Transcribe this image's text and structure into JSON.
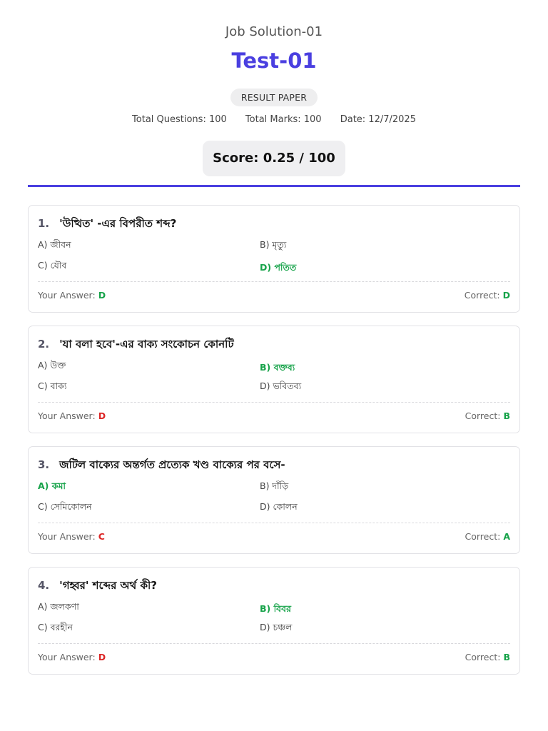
{
  "header": {
    "org": "Job Solution-01",
    "title": "Test-01",
    "badge": "RESULT PAPER",
    "total_questions": "Total Questions: 100",
    "total_marks": "Total Marks: 100",
    "date": "Date: 12/7/2025",
    "score": "Score: 0.25 / 100"
  },
  "colors": {
    "accent": "#4a3fe0",
    "correct": "#17a34a",
    "wrong": "#dc2626"
  },
  "labels": {
    "your_answer": "Your Answer:",
    "correct": "Correct:"
  },
  "questions": [
    {
      "num": "1.",
      "text": "'উত্থিত' -এর বিপরীত শব্দ?",
      "options": [
        "A) জীবন",
        "B) মৃত্যু",
        "C) যৌব",
        "D) পতিত"
      ],
      "correct_index": 3,
      "your_answer": "D",
      "correct": "D"
    },
    {
      "num": "2.",
      "text": "'যা বলা হবে'-এর বাক্য সংকোচন কোনটি",
      "options": [
        "A) উক্ত",
        "B) বক্তব্য",
        "C) বাক্য",
        "D) ভবিতব্য"
      ],
      "correct_index": 1,
      "your_answer": "D",
      "correct": "B"
    },
    {
      "num": "3.",
      "text": "জটিল বাক্যের অন্তর্গত প্রত্যেক খণ্ড বাক্যের পর বসে-",
      "options": [
        "A) কমা",
        "B) দাঁড়ি",
        "C) সেমিকোলন",
        "D) কোলন"
      ],
      "correct_index": 0,
      "your_answer": "C",
      "correct": "A"
    },
    {
      "num": "4.",
      "text": "'গহ্বর' শব্দের অর্থ কী?",
      "options": [
        "A) জলকণা",
        "B) বিবর",
        "C) বরহীন",
        "D) চঞ্চল"
      ],
      "correct_index": 1,
      "your_answer": "D",
      "correct": "B"
    }
  ]
}
